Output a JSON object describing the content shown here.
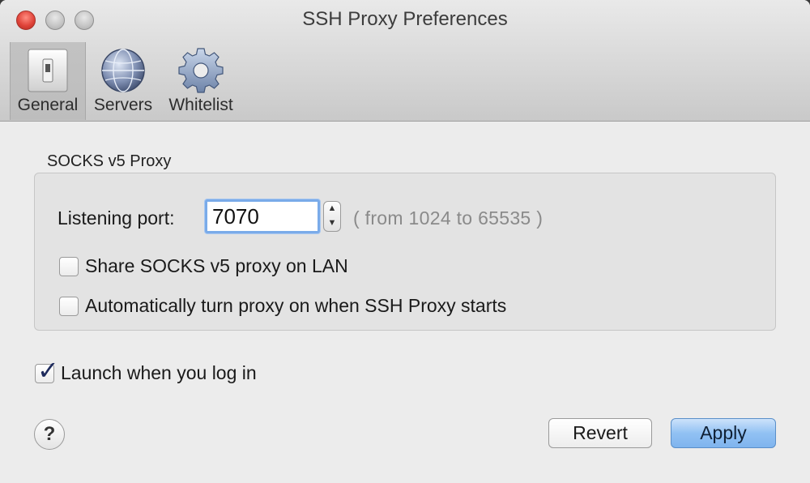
{
  "window": {
    "title": "SSH Proxy Preferences"
  },
  "toolbar": {
    "items": [
      {
        "label": "General",
        "icon": "toggle-switch-icon",
        "selected": true
      },
      {
        "label": "Servers",
        "icon": "globe-icon",
        "selected": false
      },
      {
        "label": "Whitelist",
        "icon": "gear-icon",
        "selected": false
      }
    ]
  },
  "socks": {
    "section_label": "SOCKS v5 Proxy",
    "port_label": "Listening port:",
    "port_value": "7070",
    "port_range": "( from 1024 to 65535 )",
    "share_label": "Share SOCKS v5 proxy on LAN",
    "share_checked": false,
    "auto_label": "Automatically turn proxy on when SSH Proxy starts",
    "auto_checked": false
  },
  "launch": {
    "label": "Launch when you log in",
    "checked": true
  },
  "buttons": {
    "help": "?",
    "revert": "Revert",
    "apply": "Apply"
  },
  "colors": {
    "accent": "#7aabe9",
    "apply_button": "#91c1f3",
    "close_button": "#e0443a"
  }
}
